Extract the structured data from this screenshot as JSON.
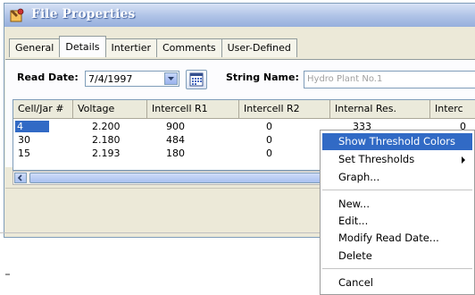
{
  "window": {
    "title": "File Properties"
  },
  "tabs": [
    "General",
    "Details",
    "Intertier",
    "Comments",
    "User-Defined"
  ],
  "active_tab": "Details",
  "filters": {
    "read_date_label": "Read Date:",
    "read_date_value": "7/4/1997",
    "string_name_label": "String Name:",
    "string_name_value": "Hydro Plant No.1"
  },
  "grid": {
    "columns": [
      "Cell/Jar #",
      "Voltage",
      "Intercell R1",
      "Intercell R2",
      "Internal Res.",
      "Interc"
    ],
    "rows": [
      [
        "4",
        "2.200",
        "900",
        "0",
        "333",
        "0"
      ],
      [
        "30",
        "2.180",
        "484",
        "0",
        "",
        ""
      ],
      [
        "15",
        "2.193",
        "180",
        "0",
        "",
        ""
      ]
    ]
  },
  "context_menu": {
    "items": [
      "Show Threshold Colors",
      "Set Thresholds",
      "Graph...",
      "New...",
      "Edit...",
      "Modify Read Date...",
      "Delete",
      "Cancel"
    ],
    "highlighted": "Show Threshold Colors"
  },
  "colors": {
    "selection": "#316ac5",
    "titlebar": "#aec2e6",
    "window_bg": "#ece9d8"
  }
}
